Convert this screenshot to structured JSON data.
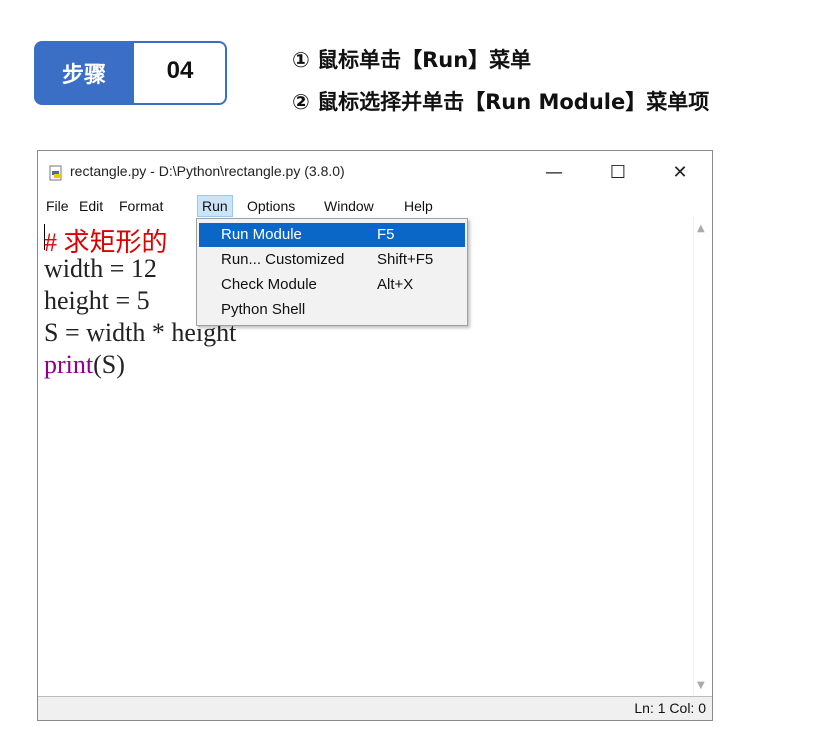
{
  "step": {
    "label": "步骤",
    "number": "04",
    "instruction1": "① 鼠标单击【Run】菜单",
    "instruction2": "② 鼠标选择并单击【Run Module】菜单项"
  },
  "window": {
    "title": "rectangle.py - D:\\Python\\rectangle.py (3.8.0)",
    "controls": {
      "minimize": "—",
      "maximize": "☐",
      "close": "✕"
    }
  },
  "menubar": {
    "items": [
      {
        "label": "File"
      },
      {
        "label": "Edit"
      },
      {
        "label": "Format"
      },
      {
        "label": "Run",
        "active": true
      },
      {
        "label": "Options"
      },
      {
        "label": "Window"
      },
      {
        "label": "Help"
      }
    ]
  },
  "code": {
    "line1": "# 求矩形的",
    "line2": "width = 12",
    "line3": "height = 5",
    "line4": "S = width * height",
    "line5_builtin": "print",
    "line5_rest": "(S)"
  },
  "run_menu": {
    "items": [
      {
        "label": "Run Module",
        "accel": "F5",
        "highlighted": true
      },
      {
        "label": "Run... Customized",
        "accel": "Shift+F5"
      },
      {
        "label": "Check Module",
        "accel": "Alt+X"
      },
      {
        "label": "Python Shell",
        "accel": ""
      }
    ]
  },
  "status": {
    "text": "Ln: 1  Col: 0"
  },
  "colors": {
    "accent": "#3b6fc6",
    "highlight": "#0a67c8",
    "comment": "#dd0000",
    "builtin": "#900090"
  }
}
